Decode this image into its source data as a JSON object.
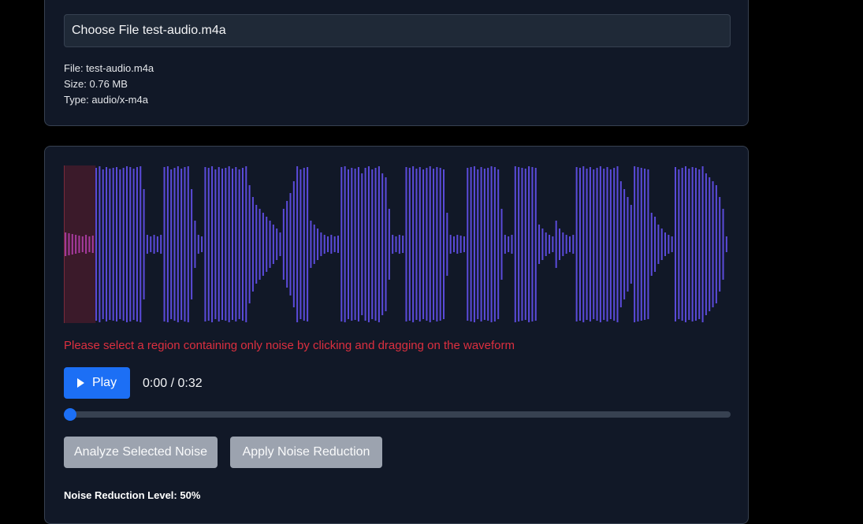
{
  "file_input": {
    "button_label": "Choose File",
    "file_name": "test-audio.m4a"
  },
  "file_info": {
    "name_line": "File: test-audio.m4a",
    "size_line": "Size: 0.76 MB",
    "type_line": "Type: audio/x-m4a"
  },
  "waveform": {
    "wave_color": "#5b4bdb",
    "selection_color": "#3b1a2a",
    "selection_wave_color": "#a83ba0",
    "selection_fraction": [
      0,
      0.048
    ],
    "amplitudes": [
      0.15,
      0.14,
      0.13,
      0.12,
      0.11,
      0.1,
      0.12,
      0.1,
      0.11,
      0.97,
      0.99,
      0.95,
      0.98,
      0.96,
      0.97,
      0.98,
      0.95,
      0.97,
      0.99,
      0.98,
      0.96,
      0.98,
      0.99,
      0.7,
      0.12,
      0.1,
      0.12,
      0.1,
      0.12,
      0.98,
      0.99,
      0.95,
      0.97,
      0.99,
      0.96,
      0.98,
      0.99,
      0.7,
      0.3,
      0.12,
      0.1,
      0.98,
      0.97,
      0.99,
      0.95,
      0.98,
      0.96,
      0.97,
      0.99,
      0.96,
      0.98,
      0.95,
      0.97,
      0.99,
      0.75,
      0.6,
      0.5,
      0.45,
      0.4,
      0.35,
      0.3,
      0.25,
      0.2,
      0.15,
      0.45,
      0.55,
      0.65,
      0.8,
      0.99,
      0.95,
      0.97,
      0.98,
      0.3,
      0.25,
      0.2,
      0.15,
      0.12,
      0.1,
      0.12,
      0.1,
      0.11,
      0.98,
      0.99,
      0.95,
      0.97,
      0.96,
      0.98,
      0.9,
      0.97,
      0.99,
      0.95,
      0.97,
      0.99,
      0.9,
      0.85,
      0.45,
      0.12,
      0.1,
      0.12,
      0.11,
      0.98,
      0.97,
      0.99,
      0.96,
      0.98,
      0.95,
      0.97,
      0.99,
      0.96,
      0.98,
      0.97,
      0.95,
      0.4,
      0.12,
      0.1,
      0.12,
      0.11,
      0.1,
      0.97,
      0.98,
      0.99,
      0.95,
      0.98,
      0.96,
      0.97,
      0.99,
      0.98,
      0.95,
      0.45,
      0.12,
      0.1,
      0.12,
      0.99,
      0.98,
      0.97,
      0.96,
      0.99,
      0.98,
      0.97,
      0.25,
      0.2,
      0.15,
      0.12,
      0.1,
      0.3,
      0.2,
      0.15,
      0.12,
      0.1,
      0.12,
      0.98,
      0.97,
      0.99,
      0.96,
      0.98,
      0.95,
      0.97,
      0.99,
      0.96,
      0.98,
      0.95,
      0.97,
      0.99,
      0.8,
      0.7,
      0.6,
      0.5,
      0.99,
      0.98,
      0.97,
      0.96,
      0.95,
      0.4,
      0.35,
      0.25,
      0.2,
      0.15,
      0.12,
      0.1,
      0.98,
      0.95,
      0.97,
      0.99,
      0.96,
      0.98,
      0.97,
      0.95,
      0.99,
      0.9,
      0.85,
      0.8,
      0.75,
      0.6,
      0.45,
      0.1
    ]
  },
  "warning_text": "Please select a region containing only noise by clicking and dragging on the waveform",
  "player": {
    "play_label": "Play",
    "time_text": "0:00 / 0:32",
    "progress": 0
  },
  "actions": {
    "analyze_label": "Analyze Selected Noise",
    "apply_label": "Apply Noise Reduction"
  },
  "noise_level": {
    "label": "Noise Reduction Level: 50%",
    "value_percent": 50
  },
  "colors": {
    "accent": "#1c6ff5",
    "warning": "#dc2f3f",
    "disabled_button": "#9ca3af"
  },
  "icons": {
    "play": "play-icon"
  }
}
